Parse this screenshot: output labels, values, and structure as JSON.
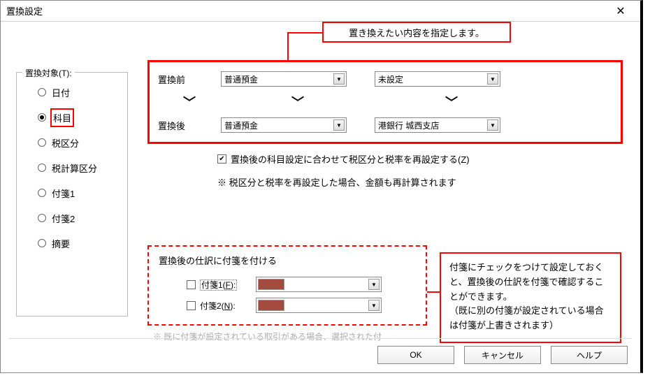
{
  "window": {
    "title": "置換設定"
  },
  "callout1": "置き換えたい内容を指定します。",
  "callout2": "付箋にチェックをつけて設定しておくと、置換後の仕訳を付箋で確認することができます。\n（既に別の付箋が設定されている場合は付箋が上書きされます）",
  "target": {
    "legend": "置換対象(T):",
    "options": [
      {
        "label": "日付",
        "checked": false
      },
      {
        "label": "科目",
        "checked": true
      },
      {
        "label": "税区分",
        "checked": false
      },
      {
        "label": "税計算区分",
        "checked": false
      },
      {
        "label": "付箋1",
        "checked": false
      },
      {
        "label": "付箋2",
        "checked": false
      },
      {
        "label": "摘要",
        "checked": false
      }
    ]
  },
  "main": {
    "before_label": "置換前",
    "after_label": "置換後",
    "before": {
      "combo1": "普通預金",
      "combo2": "未設定"
    },
    "after": {
      "combo1": "普通預金",
      "combo2": "港銀行 城西支店"
    },
    "recalc_check_label": "置換後の科目設定に合わせて税区分と税率を再設定する(Z)",
    "recalc_checked": true,
    "recalc_note": "※ 税区分と税率を再設定した場合、金額も再計算されます"
  },
  "fusen": {
    "title": "置換後の仕訳に付箋を付ける",
    "rows": [
      {
        "label_prefix": "付箋1(",
        "label_key": "F",
        "label_suffix": "):",
        "color": "#a34b3e",
        "checked": false
      },
      {
        "label_prefix": "付箋2(",
        "label_key": "N",
        "label_suffix": "):",
        "color": "#a34b3e",
        "checked": false
      }
    ],
    "truncated_note": "※ 既に付箋が設定されている取引がある場合、選択された付"
  },
  "buttons": {
    "ok": "OK",
    "cancel": "キャンセル",
    "help": "ヘルプ"
  }
}
